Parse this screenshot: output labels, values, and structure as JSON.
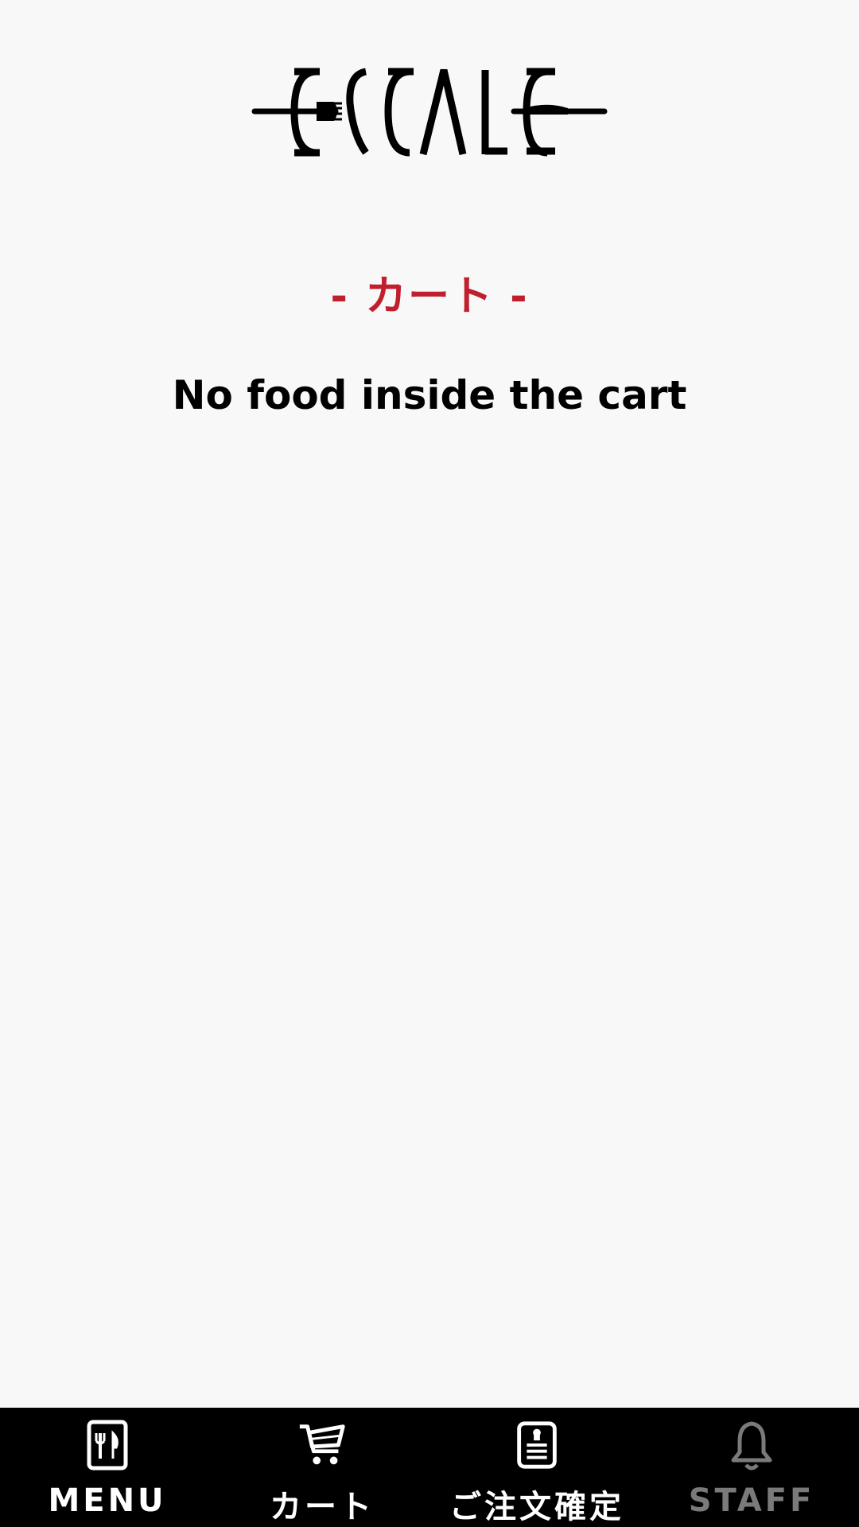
{
  "brand": {
    "logo_text": "ESCALE"
  },
  "header": {
    "title": "- カート -"
  },
  "cart": {
    "empty_message": "No food inside the cart"
  },
  "nav": {
    "items": [
      {
        "label": "MENU",
        "icon": "menu-icon",
        "enabled": true
      },
      {
        "label": "カート",
        "icon": "cart-icon",
        "enabled": true
      },
      {
        "label": "ご注文確定",
        "icon": "order-confirm-icon",
        "enabled": true
      },
      {
        "label": "STAFF",
        "icon": "bell-icon",
        "enabled": false
      }
    ]
  },
  "colors": {
    "accent": "#c0202e",
    "background": "#f8f8f8",
    "nav_background": "#000000",
    "nav_label": "#ffffff",
    "nav_label_disabled": "#7a7a7a"
  }
}
